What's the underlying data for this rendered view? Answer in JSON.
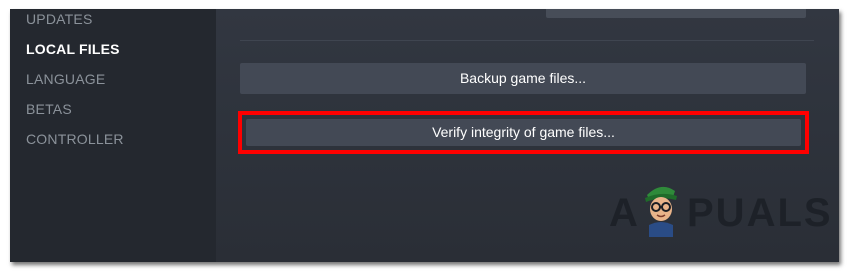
{
  "sidebar": {
    "items": [
      {
        "label": "UPDATES",
        "active": false
      },
      {
        "label": "LOCAL FILES",
        "active": true
      },
      {
        "label": "LANGUAGE",
        "active": false
      },
      {
        "label": "BETAS",
        "active": false
      },
      {
        "label": "CONTROLLER",
        "active": false
      }
    ]
  },
  "main": {
    "backup_label": "Backup game files...",
    "verify_label": "Verify integrity of game files..."
  },
  "watermark": {
    "letter_a": "A",
    "rest": "PUALS"
  },
  "colors": {
    "highlight": "#ff0000",
    "panel": "#2c313b",
    "sidebar": "#24282f",
    "button": "#434955"
  }
}
